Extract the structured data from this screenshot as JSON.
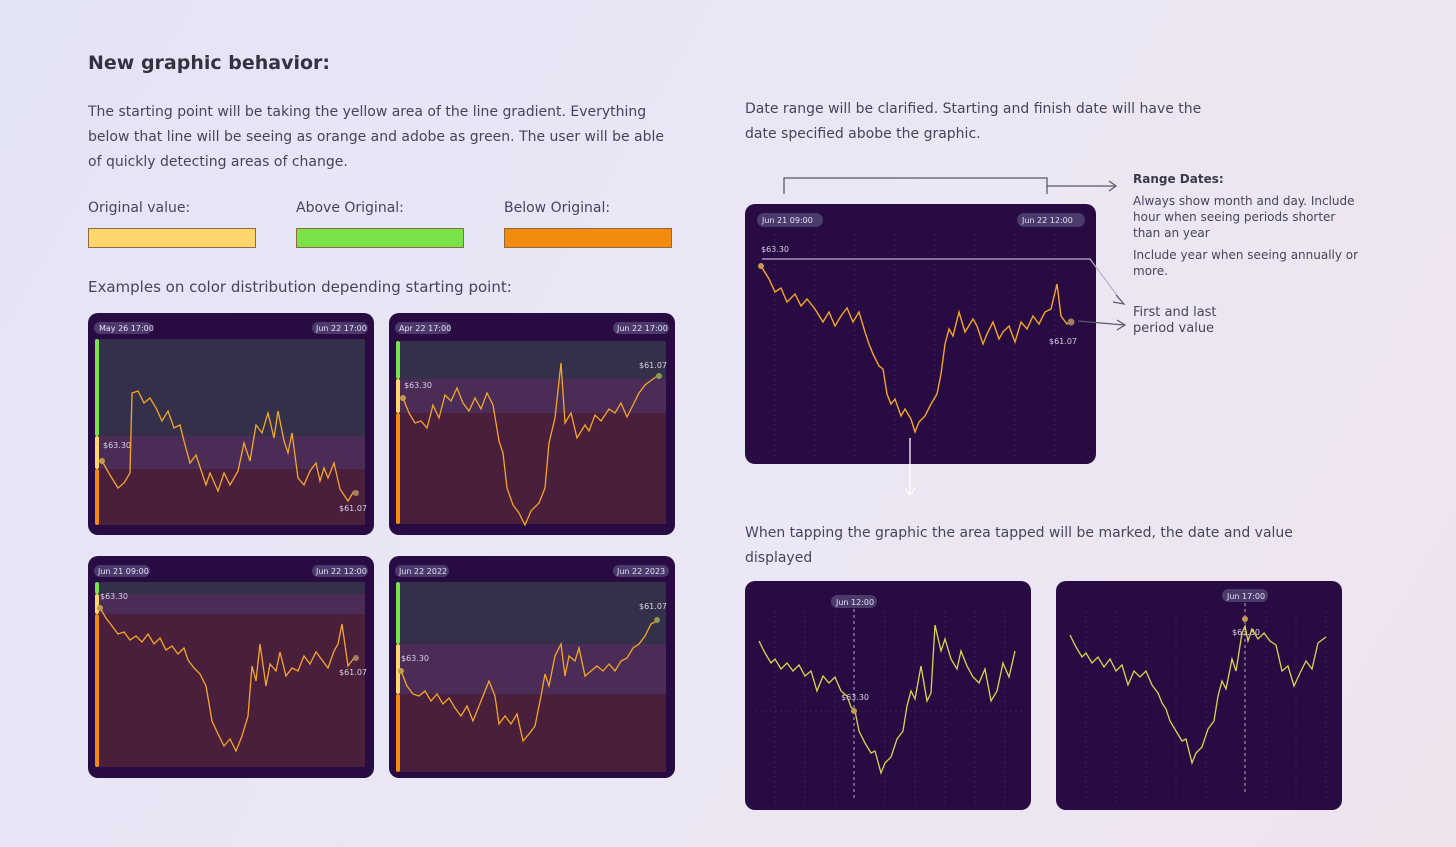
{
  "heading": "New graphic behavior:",
  "intro": "The starting point will be taking the yellow area of the line gradient. Everything below that line will be seeing as orange and adobe as green. The user will be able of quickly detecting areas of change.",
  "legend": [
    {
      "label": "Original value:",
      "color": "#ffd56e"
    },
    {
      "label": "Above Original:",
      "color": "#7ae34a"
    },
    {
      "label": "Below Original:",
      "color": "#f38b0f"
    }
  ],
  "examples_title": "Examples on color distribution depending starting point:",
  "examples": [
    {
      "start_date": "May 26 17:00",
      "end_date": "Jun 22 17:00",
      "start_value": "$63.30",
      "end_value": "$61.07"
    },
    {
      "start_date": "Apr 22 17:00",
      "end_date": "Jun 22 17:00",
      "start_value": "$63.30",
      "end_value": "$61.07"
    },
    {
      "start_date": "Jun 21 09:00",
      "end_date": "Jun 22 12:00",
      "start_value": "$63.30",
      "end_value": "$61.07"
    },
    {
      "start_date": "Jun 22 2022",
      "end_date": "Jun 22 2023",
      "start_value": "$63.30",
      "end_value": "$61.07"
    }
  ],
  "date_range_text": "Date range will be clarified. Starting and finish date will have the date specified abobe the graphic.",
  "main_chart": {
    "start_date": "Jun 21 09:00",
    "end_date": "Jun 22 12:00",
    "start_value": "$63.30",
    "end_value": "$61.07"
  },
  "range_dates": {
    "title": "Range Dates:",
    "line1": "Always show month and day. Include hour when seeing periods shorter than an year",
    "line2": "Include year when seeing annually or more."
  },
  "first_last_note": "First and last period value",
  "tap_text": "When tapping the graphic the area tapped will be marked, the date and value displayed",
  "tap_examples": [
    {
      "date": "Jun 12:00",
      "value": "$63.30"
    },
    {
      "date": "Jun 17:00",
      "value": "$63.30"
    }
  ],
  "colors": {
    "card_bg": "#280b43",
    "line_orange": "#f5a623",
    "line_green": "#a6e35a",
    "line_yellow": "#ffd56e"
  }
}
